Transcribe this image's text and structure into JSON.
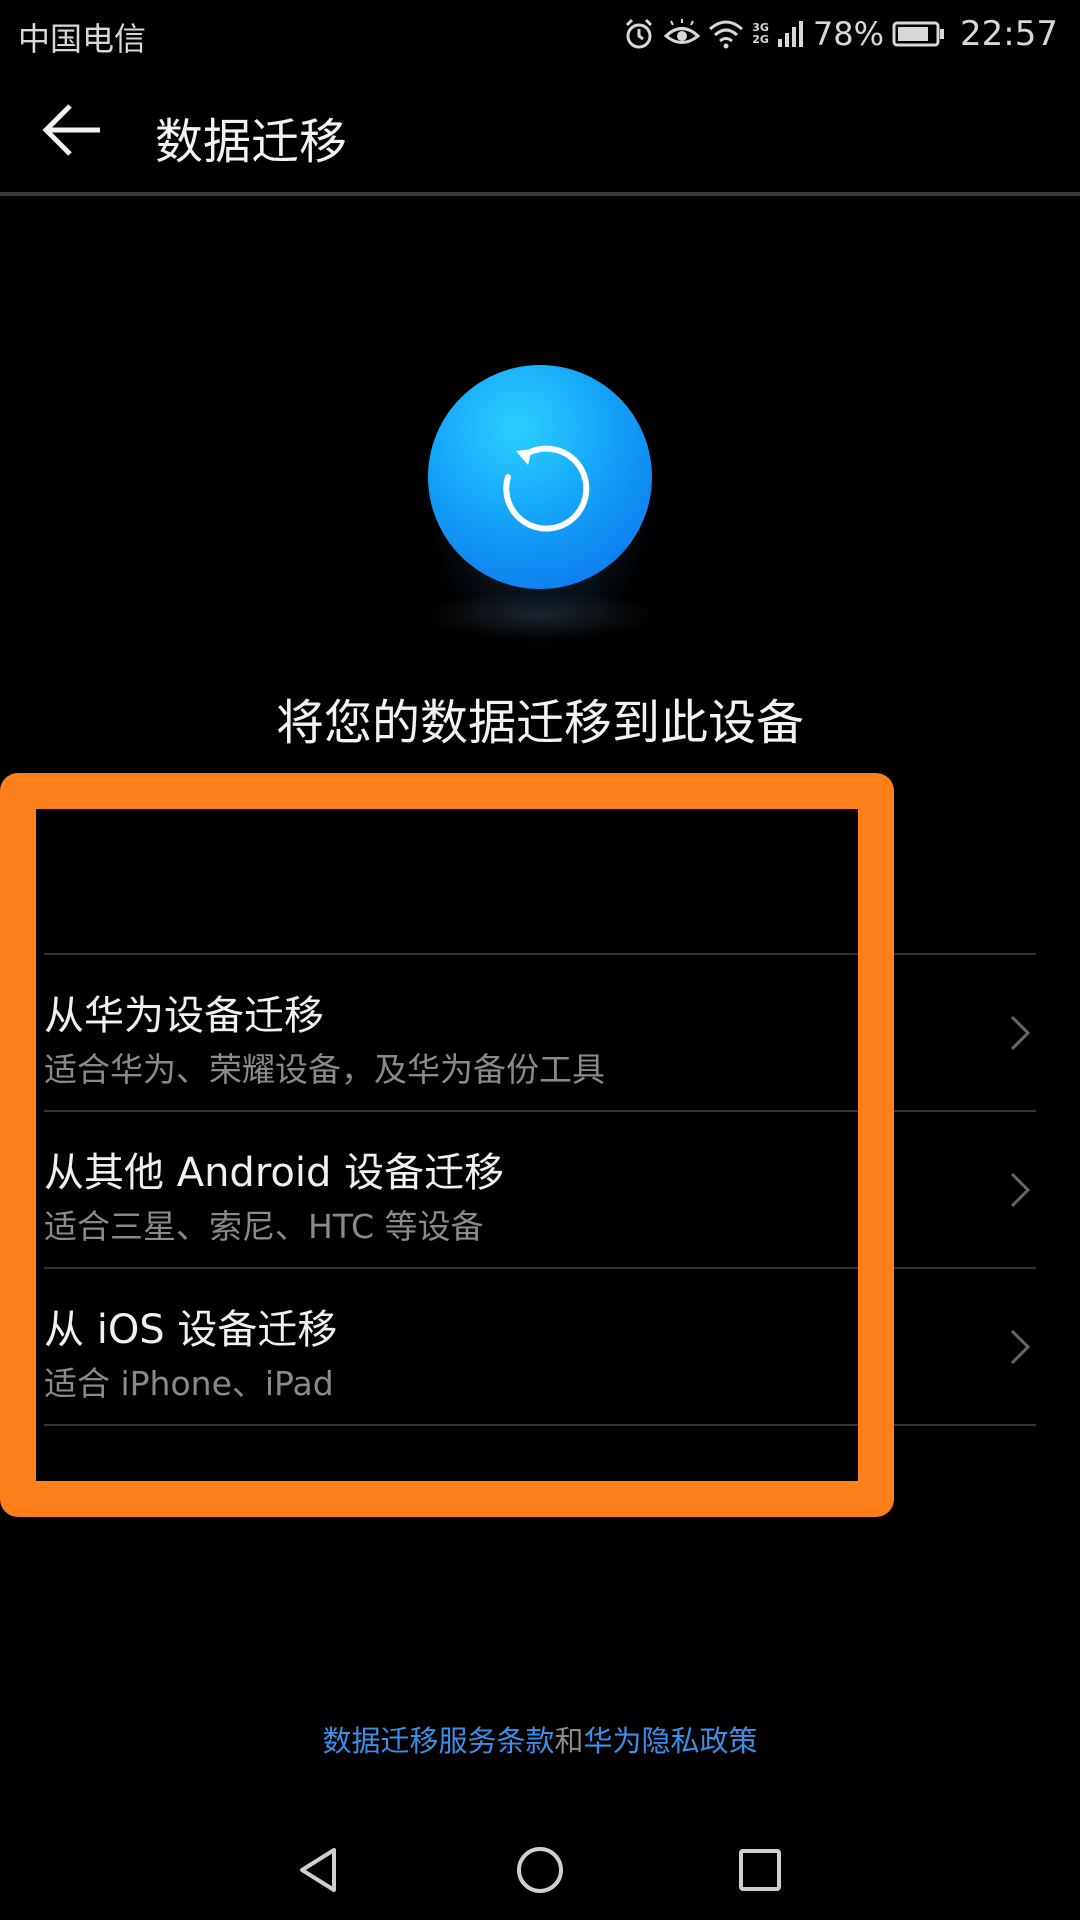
{
  "status_bar": {
    "carrier": "中国电信",
    "network_top": "3G",
    "network_bottom": "2G",
    "battery_percent": "78%",
    "time": "22:57",
    "icons": [
      "alarm-icon",
      "eye-comfort-icon",
      "wifi-icon",
      "signal-icon",
      "battery-icon"
    ]
  },
  "app_bar": {
    "title": "数据迁移",
    "back_icon": "arrow-left-icon"
  },
  "hero": {
    "icon": "refresh-icon",
    "heading": "将您的数据迁移到此设备",
    "icon_color": "#13a2f7"
  },
  "options": [
    {
      "title": "从华为设备迁移",
      "subtitle": "适合华为、荣耀设备，及华为备份工具"
    },
    {
      "title": "从其他 Android 设备迁移",
      "subtitle": "适合三星、索尼、HTC 等设备"
    },
    {
      "title": "从 iOS 设备迁移",
      "subtitle": "适合 iPhone、iPad"
    }
  ],
  "footer": {
    "terms_link": "数据迁移服务条款",
    "conjunction": "和",
    "privacy_link": "华为隐私政策",
    "link_color": "#3c8fe6"
  },
  "highlight_color": "#ff7f1a",
  "nav_bar": {
    "icons": [
      "back-triangle-icon",
      "home-circle-icon",
      "recents-square-icon"
    ]
  }
}
